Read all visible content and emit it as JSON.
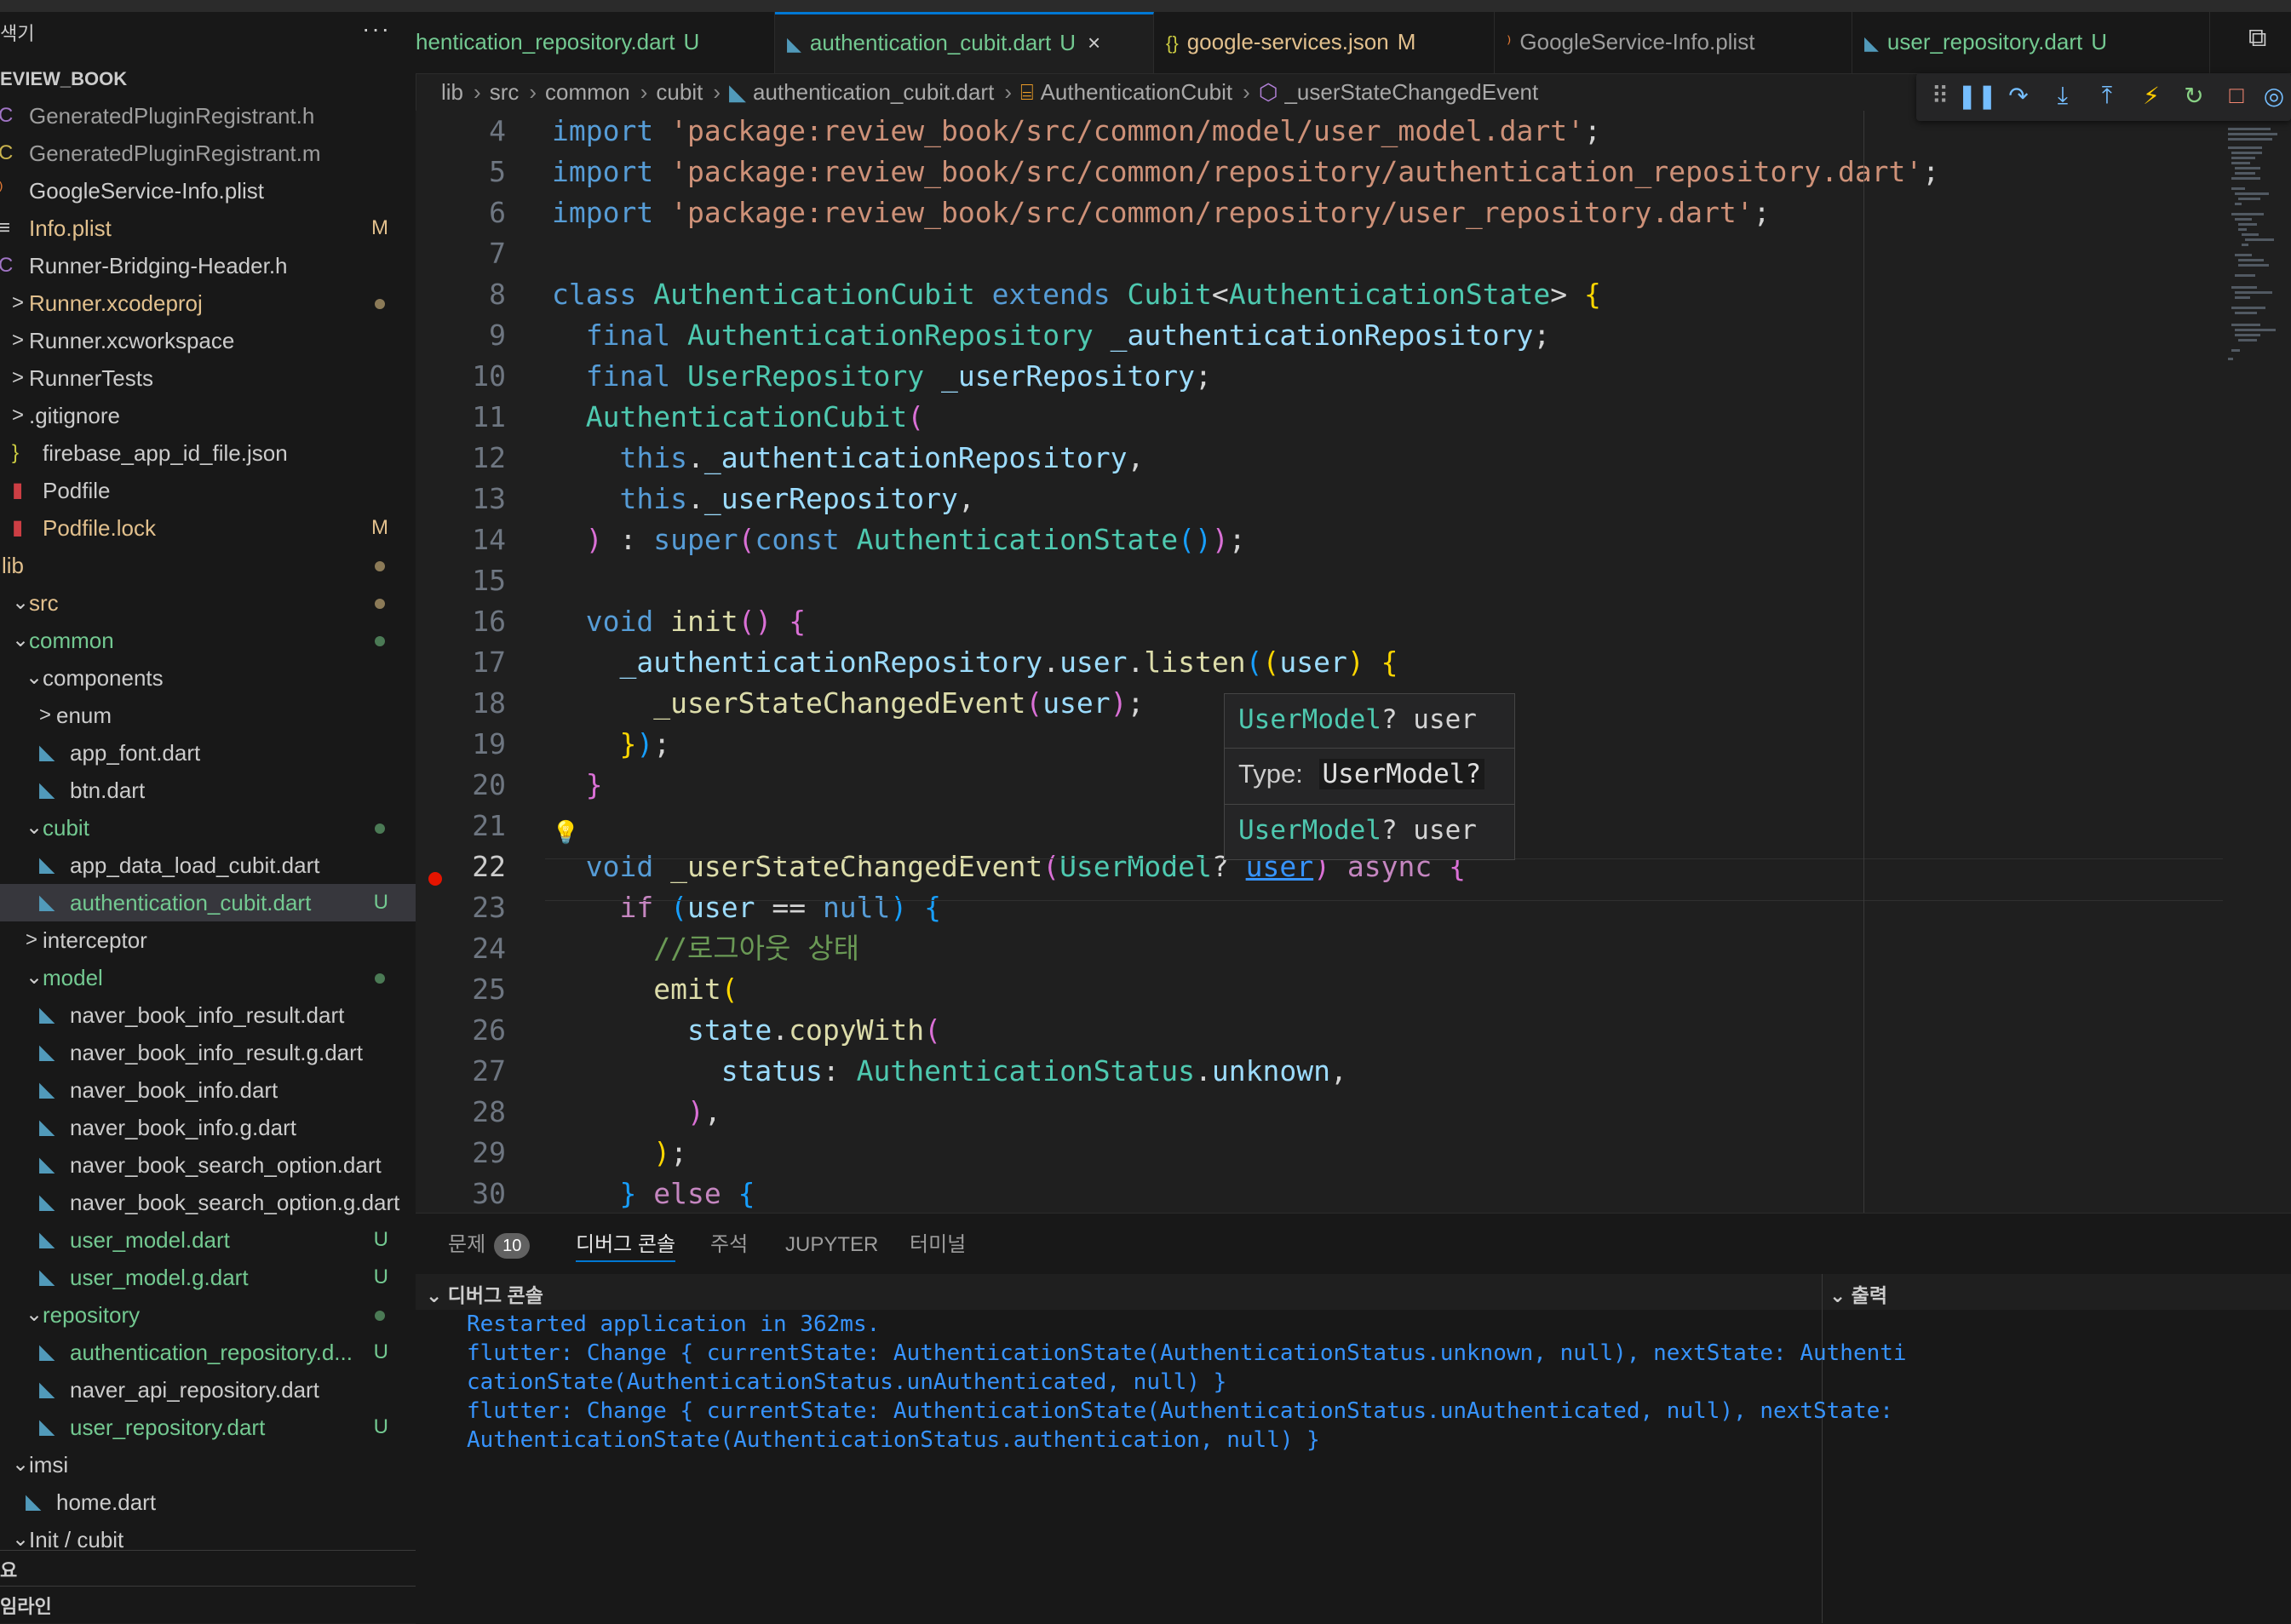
{
  "explorer": {
    "title": "색기",
    "more": "···",
    "project": "EVIEW_BOOK",
    "items": [
      {
        "label": "GeneratedPluginRegistrant.h",
        "icon": "C",
        "icon_color": "#a074c4",
        "color": "#9d9d9d",
        "badge": "",
        "dot": ""
      },
      {
        "label": "GeneratedPluginRegistrant.m",
        "icon": "C",
        "icon_color": "#c9b34d",
        "color": "#9d9d9d",
        "badge": "",
        "dot": ""
      },
      {
        "label": "GoogleService-Info.plist",
        "icon": "rss",
        "icon_color": "#e37933",
        "color": "#cccccc",
        "badge": "",
        "dot": ""
      },
      {
        "label": "Info.plist",
        "icon": "≡",
        "icon_color": "#cccccc",
        "color": "#e2c08d",
        "badge": "M",
        "dot": ""
      },
      {
        "label": "Runner-Bridging-Header.h",
        "icon": "C",
        "icon_color": "#a074c4",
        "color": "#cccccc",
        "badge": "",
        "dot": ""
      },
      {
        "label": "Runner.xcodeproj",
        "icon": ">",
        "icon_color": "#cccccc",
        "color": "#e2c08d",
        "badge": "",
        "dot": "#8b7a57"
      },
      {
        "label": "Runner.xcworkspace",
        "icon": ">",
        "icon_color": "#cccccc",
        "color": "#cccccc",
        "badge": "",
        "dot": ""
      },
      {
        "label": "RunnerTests",
        "icon": ">",
        "icon_color": "#cccccc",
        "color": "#cccccc",
        "badge": "",
        "dot": ""
      },
      {
        "label": ".gitignore",
        "icon": ">",
        "icon_color": "#cccccc",
        "color": "#cccccc",
        "badge": "",
        "dot": ""
      },
      {
        "label": "firebase_app_id_file.json",
        "icon": "}",
        "icon_color": "#cbcb41",
        "color": "#cccccc",
        "badge": "",
        "dot": ""
      },
      {
        "label": "Podfile",
        "icon": "▮",
        "icon_color": "#cc3e44",
        "color": "#cccccc",
        "badge": "",
        "dot": ""
      },
      {
        "label": "Podfile.lock",
        "icon": "▮",
        "icon_color": "#cc3e44",
        "color": "#e2c08d",
        "badge": "M",
        "dot": ""
      },
      {
        "label": "lib",
        "icon": "",
        "icon_color": "#cccccc",
        "color": "#e2c08d",
        "badge": "",
        "dot": "#8b7a57"
      },
      {
        "label": "src",
        "icon": "⌄",
        "icon_color": "#cccccc",
        "color": "#e2c08d",
        "badge": "",
        "dot": "#8b7a57"
      },
      {
        "label": "common",
        "icon": "⌄",
        "icon_color": "#cccccc",
        "color": "#73c991",
        "badge": "",
        "dot": "#4b7a55"
      },
      {
        "label": "components",
        "icon": "⌄",
        "icon_color": "#cccccc",
        "color": "#cccccc",
        "badge": "",
        "dot": ""
      },
      {
        "label": "enum",
        "icon": ">",
        "icon_color": "#cccccc",
        "color": "#cccccc",
        "badge": "",
        "dot": ""
      },
      {
        "label": "app_font.dart",
        "icon": "◣",
        "icon_color": "#519aba",
        "color": "#cccccc",
        "badge": "",
        "dot": ""
      },
      {
        "label": "btn.dart",
        "icon": "◣",
        "icon_color": "#519aba",
        "color": "#cccccc",
        "badge": "",
        "dot": ""
      },
      {
        "label": "cubit",
        "icon": "⌄",
        "icon_color": "#cccccc",
        "color": "#73c991",
        "badge": "",
        "dot": "#4b7a55"
      },
      {
        "label": "app_data_load_cubit.dart",
        "icon": "◣",
        "icon_color": "#519aba",
        "color": "#cccccc",
        "badge": "",
        "dot": ""
      },
      {
        "label": "authentication_cubit.dart",
        "icon": "◣",
        "icon_color": "#519aba",
        "color": "#73c991",
        "badge": "U",
        "dot": ""
      },
      {
        "label": "interceptor",
        "icon": ">",
        "icon_color": "#cccccc",
        "color": "#cccccc",
        "badge": "",
        "dot": ""
      },
      {
        "label": "model",
        "icon": "⌄",
        "icon_color": "#cccccc",
        "color": "#73c991",
        "badge": "",
        "dot": "#4b7a55"
      },
      {
        "label": "naver_book_info_result.dart",
        "icon": "◣",
        "icon_color": "#519aba",
        "color": "#cccccc",
        "badge": "",
        "dot": ""
      },
      {
        "label": "naver_book_info_result.g.dart",
        "icon": "◣",
        "icon_color": "#519aba",
        "color": "#cccccc",
        "badge": "",
        "dot": ""
      },
      {
        "label": "naver_book_info.dart",
        "icon": "◣",
        "icon_color": "#519aba",
        "color": "#cccccc",
        "badge": "",
        "dot": ""
      },
      {
        "label": "naver_book_info.g.dart",
        "icon": "◣",
        "icon_color": "#519aba",
        "color": "#cccccc",
        "badge": "",
        "dot": ""
      },
      {
        "label": "naver_book_search_option.dart",
        "icon": "◣",
        "icon_color": "#519aba",
        "color": "#cccccc",
        "badge": "",
        "dot": ""
      },
      {
        "label": "naver_book_search_option.g.dart",
        "icon": "◣",
        "icon_color": "#519aba",
        "color": "#cccccc",
        "badge": "",
        "dot": ""
      },
      {
        "label": "user_model.dart",
        "icon": "◣",
        "icon_color": "#519aba",
        "color": "#73c991",
        "badge": "U",
        "dot": ""
      },
      {
        "label": "user_model.g.dart",
        "icon": "◣",
        "icon_color": "#519aba",
        "color": "#73c991",
        "badge": "U",
        "dot": ""
      },
      {
        "label": "repository",
        "icon": "⌄",
        "icon_color": "#cccccc",
        "color": "#73c991",
        "badge": "",
        "dot": "#4b7a55"
      },
      {
        "label": "authentication_repository.d...",
        "icon": "◣",
        "icon_color": "#519aba",
        "color": "#73c991",
        "badge": "U",
        "dot": ""
      },
      {
        "label": "naver_api_repository.dart",
        "icon": "◣",
        "icon_color": "#519aba",
        "color": "#cccccc",
        "badge": "",
        "dot": ""
      },
      {
        "label": "user_repository.dart",
        "icon": "◣",
        "icon_color": "#519aba",
        "color": "#73c991",
        "badge": "U",
        "dot": ""
      },
      {
        "label": "imsi",
        "icon": "⌄",
        "icon_color": "#cccccc",
        "color": "#cccccc",
        "badge": "",
        "dot": ""
      },
      {
        "label": "home.dart",
        "icon": "◣",
        "icon_color": "#519aba",
        "color": "#cccccc",
        "badge": "",
        "dot": ""
      },
      {
        "label": "Init / cubit",
        "icon": "⌄",
        "icon_color": "#cccccc",
        "color": "#cccccc",
        "badge": "",
        "dot": ""
      }
    ],
    "bottom1": "요",
    "bottom2": "임라인"
  },
  "tabs": [
    {
      "label": "hentication_repository.dart",
      "status": "U",
      "status_color": "#73c991",
      "color": "#73c991",
      "icon": "",
      "active": false,
      "close": ""
    },
    {
      "label": "authentication_cubit.dart",
      "status": "U",
      "status_color": "#73c991",
      "color": "#73c991",
      "icon": "◣",
      "active": true,
      "close": "×"
    },
    {
      "label": "google-services.json",
      "status": "M",
      "status_color": "#e2c08d",
      "color": "#e2c08d",
      "icon": "{}",
      "active": false,
      "close": ""
    },
    {
      "label": "GoogleService-Info.plist",
      "status": "",
      "status_color": "#cccccc",
      "color": "#9d9d9d",
      "icon": "rss",
      "active": false,
      "close": ""
    },
    {
      "label": "user_repository.dart",
      "status": "U",
      "status_color": "#73c991",
      "color": "#73c991",
      "icon": "◣",
      "active": false,
      "close": ""
    }
  ],
  "breadcrumb": [
    "lib",
    "src",
    "common",
    "cubit",
    "authentication_cubit.dart",
    "AuthenticationCubit",
    "_userStateChangedEvent"
  ],
  "editor": {
    "current_line": "22",
    "lines": [
      {
        "n": "4",
        "tokens": [
          [
            "kw",
            "import "
          ],
          [
            "str",
            "'package:review_book/src/common/model/user_model.dart'"
          ],
          [
            "pl",
            ";"
          ]
        ]
      },
      {
        "n": "5",
        "tokens": [
          [
            "kw",
            "import "
          ],
          [
            "str",
            "'package:review_book/src/common/repository/authentication_repository.dart'"
          ],
          [
            "pl",
            ";"
          ]
        ]
      },
      {
        "n": "6",
        "tokens": [
          [
            "kw",
            "import "
          ],
          [
            "str",
            "'package:review_book/src/common/repository/user_repository.dart'"
          ],
          [
            "pl",
            ";"
          ]
        ]
      },
      {
        "n": "7",
        "tokens": []
      },
      {
        "n": "8",
        "tokens": [
          [
            "kw",
            "class "
          ],
          [
            "ty",
            "AuthenticationCubit "
          ],
          [
            "kw",
            "extends "
          ],
          [
            "ty",
            "Cubit"
          ],
          [
            "pl",
            "<"
          ],
          [
            "ty",
            "AuthenticationState"
          ],
          [
            "pl",
            "> "
          ],
          [
            "br1",
            "{"
          ]
        ]
      },
      {
        "n": "9",
        "tokens": [
          [
            "pl",
            "  "
          ],
          [
            "kw",
            "final "
          ],
          [
            "ty",
            "AuthenticationRepository "
          ],
          [
            "var",
            "_authenticationRepository"
          ],
          [
            "pl",
            ";"
          ]
        ]
      },
      {
        "n": "10",
        "tokens": [
          [
            "pl",
            "  "
          ],
          [
            "kw",
            "final "
          ],
          [
            "ty",
            "UserRepository "
          ],
          [
            "var",
            "_userRepository"
          ],
          [
            "pl",
            ";"
          ]
        ]
      },
      {
        "n": "11",
        "tokens": [
          [
            "pl",
            "  "
          ],
          [
            "ty",
            "AuthenticationCubit"
          ],
          [
            "br2",
            "("
          ]
        ]
      },
      {
        "n": "12",
        "tokens": [
          [
            "pl",
            "    "
          ],
          [
            "kw",
            "this"
          ],
          [
            "pl",
            "."
          ],
          [
            "var",
            "_authenticationRepository"
          ],
          [
            "pl",
            ","
          ]
        ]
      },
      {
        "n": "13",
        "tokens": [
          [
            "pl",
            "    "
          ],
          [
            "kw",
            "this"
          ],
          [
            "pl",
            "."
          ],
          [
            "var",
            "_userRepository"
          ],
          [
            "pl",
            ","
          ]
        ]
      },
      {
        "n": "14",
        "tokens": [
          [
            "pl",
            "  "
          ],
          [
            "br2",
            ")"
          ],
          [
            "pl",
            " : "
          ],
          [
            "kw",
            "super"
          ],
          [
            "br2",
            "("
          ],
          [
            "kw",
            "const "
          ],
          [
            "ty",
            "AuthenticationState"
          ],
          [
            "br3",
            "()"
          ],
          [
            "br2",
            ")"
          ],
          [
            "pl",
            ";"
          ]
        ]
      },
      {
        "n": "15",
        "tokens": []
      },
      {
        "n": "16",
        "tokens": [
          [
            "pl",
            "  "
          ],
          [
            "kw",
            "void "
          ],
          [
            "fn",
            "init"
          ],
          [
            "br2",
            "()"
          ],
          [
            "pl",
            " "
          ],
          [
            "br2",
            "{"
          ]
        ]
      },
      {
        "n": "17",
        "tokens": [
          [
            "pl",
            "    "
          ],
          [
            "var",
            "_authenticationRepository"
          ],
          [
            "pl",
            "."
          ],
          [
            "var",
            "user"
          ],
          [
            "pl",
            "."
          ],
          [
            "fn",
            "listen"
          ],
          [
            "br3",
            "("
          ],
          [
            "br1",
            "("
          ],
          [
            "var",
            "user"
          ],
          [
            "br1",
            ")"
          ],
          [
            "pl",
            " "
          ],
          [
            "br1",
            "{"
          ]
        ]
      },
      {
        "n": "18",
        "tokens": [
          [
            "pl",
            "      "
          ],
          [
            "fn",
            "_userStateChangedEvent"
          ],
          [
            "br2",
            "("
          ],
          [
            "var",
            "user"
          ],
          [
            "br2",
            ")"
          ],
          [
            "pl",
            ";"
          ]
        ]
      },
      {
        "n": "19",
        "tokens": [
          [
            "pl",
            "    "
          ],
          [
            "br1",
            "}"
          ],
          [
            "br3",
            ")"
          ],
          [
            "pl",
            ";"
          ]
        ]
      },
      {
        "n": "20",
        "tokens": [
          [
            "pl",
            "  "
          ],
          [
            "br2",
            "}"
          ]
        ]
      },
      {
        "n": "21",
        "tokens": []
      },
      {
        "n": "22",
        "tokens": [
          [
            "pl",
            "  "
          ],
          [
            "kw",
            "void "
          ],
          [
            "fn",
            "_userStateChangedEvent"
          ],
          [
            "br2",
            "("
          ],
          [
            "ty",
            "UserModel"
          ],
          [
            "pl",
            "? "
          ],
          [
            "var",
            "user"
          ],
          [
            "br2",
            ")"
          ],
          [
            "pl",
            " "
          ],
          [
            "ctl",
            "async"
          ],
          [
            "pl",
            " "
          ],
          [
            "br2",
            "{"
          ]
        ]
      },
      {
        "n": "23",
        "tokens": [
          [
            "pl",
            "    "
          ],
          [
            "ctl",
            "if "
          ],
          [
            "br3",
            "("
          ],
          [
            "var",
            "user"
          ],
          [
            "pl",
            " == "
          ],
          [
            "kw",
            "null"
          ],
          [
            "br3",
            ")"
          ],
          [
            "pl",
            " "
          ],
          [
            "br3",
            "{"
          ]
        ]
      },
      {
        "n": "24",
        "tokens": [
          [
            "pl",
            "      "
          ],
          [
            "cm",
            "//로그아웃 상태"
          ]
        ]
      },
      {
        "n": "25",
        "tokens": [
          [
            "pl",
            "      "
          ],
          [
            "fn",
            "emit"
          ],
          [
            "br1",
            "("
          ]
        ]
      },
      {
        "n": "26",
        "tokens": [
          [
            "pl",
            "        "
          ],
          [
            "var",
            "state"
          ],
          [
            "pl",
            "."
          ],
          [
            "fn",
            "copyWith"
          ],
          [
            "br2",
            "("
          ]
        ]
      },
      {
        "n": "27",
        "tokens": [
          [
            "pl",
            "          "
          ],
          [
            "var",
            "status"
          ],
          [
            "pl",
            ": "
          ],
          [
            "ty",
            "AuthenticationStatus"
          ],
          [
            "pl",
            "."
          ],
          [
            "var",
            "unknown"
          ],
          [
            "pl",
            ","
          ]
        ]
      },
      {
        "n": "28",
        "tokens": [
          [
            "pl",
            "        "
          ],
          [
            "br2",
            ")"
          ],
          [
            "pl",
            ","
          ]
        ]
      },
      {
        "n": "29",
        "tokens": [
          [
            "pl",
            "      "
          ],
          [
            "br1",
            ")"
          ],
          [
            "pl",
            ";"
          ]
        ]
      },
      {
        "n": "30",
        "tokens": [
          [
            "pl",
            "    "
          ],
          [
            "br3",
            "}"
          ],
          [
            "pl",
            " "
          ],
          [
            "ctl",
            "else "
          ],
          [
            "br3",
            "{"
          ]
        ]
      }
    ]
  },
  "hover": {
    "line1_type": "UserModel",
    "line1_rest": "? user",
    "type_label": "Type:",
    "type_value": "UserModel?",
    "line3_type": "UserModel",
    "line3_rest": "? user"
  },
  "panel": {
    "tabs": [
      "문제",
      "디버그 콘솔",
      "주석",
      "JUPYTER",
      "터미널"
    ],
    "problem_count": "10",
    "active_tab": "디버그 콘솔",
    "debug_console_title": "디버그 콘솔",
    "output_title": "출력",
    "console_lines": [
      "Restarted application in 362ms.",
      "flutter: Change { currentState: AuthenticationState(AuthenticationStatus.unknown, null), nextState: Authenti",
      "cationState(AuthenticationStatus.unAuthenticated, null) }",
      "flutter: Change { currentState: AuthenticationState(AuthenticationStatus.unAuthenticated, null), nextState:",
      "AuthenticationState(AuthenticationStatus.authentication, null) }"
    ]
  },
  "colors": {
    "accent": "#0078d4",
    "untracked": "#73c991",
    "modified": "#e2c08d",
    "console_text": "#3794ff"
  }
}
